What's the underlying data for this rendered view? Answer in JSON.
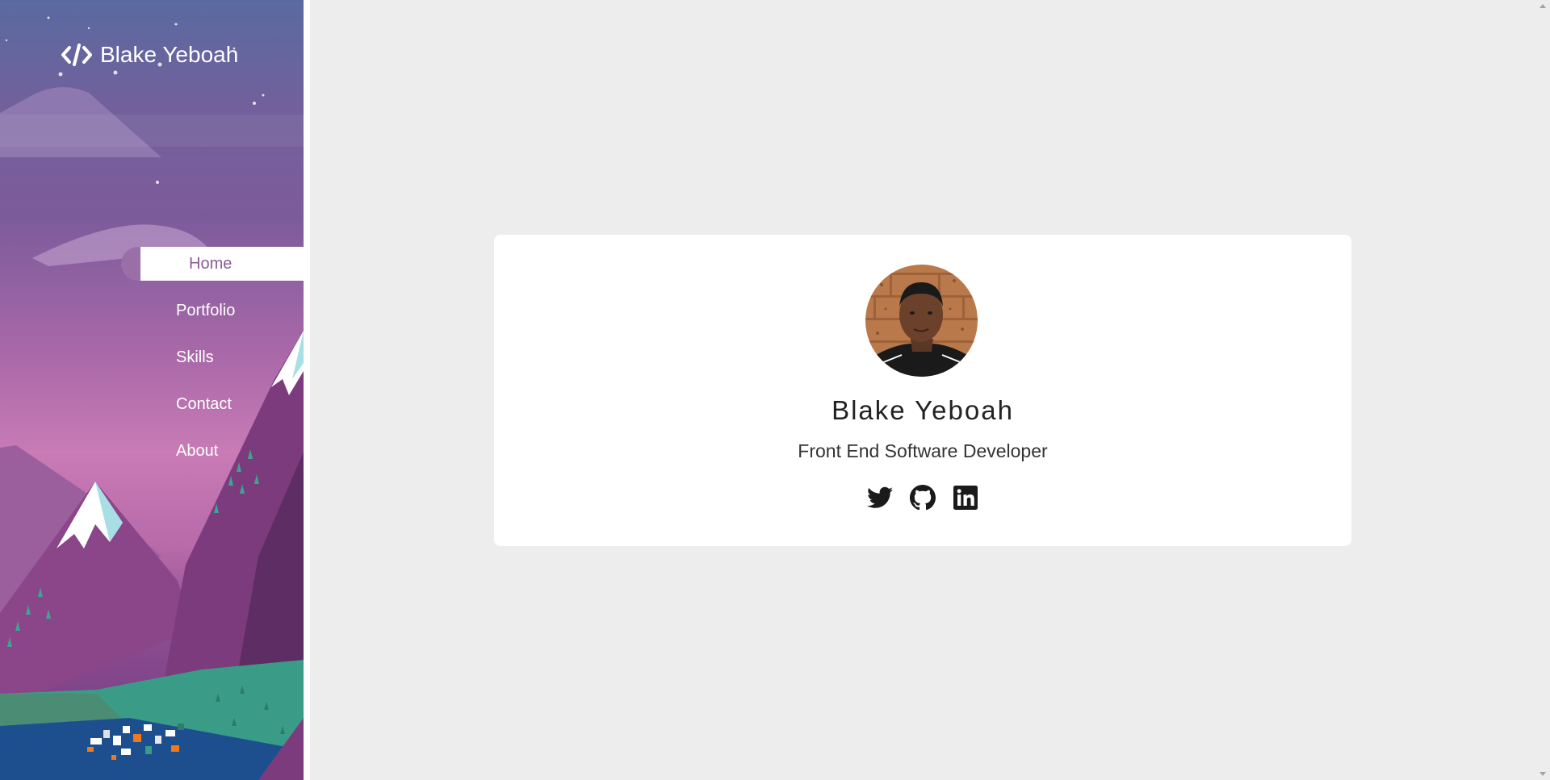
{
  "brand": {
    "name": "Blake Yeboah",
    "icon": "code-icon"
  },
  "nav": {
    "items": [
      {
        "label": "Home",
        "active": true
      },
      {
        "label": "Portfolio",
        "active": false
      },
      {
        "label": "Skills",
        "active": false
      },
      {
        "label": "Contact",
        "active": false
      },
      {
        "label": "About",
        "active": false
      }
    ]
  },
  "profile": {
    "name": "Blake Yeboah",
    "role": "Front End Software Developer",
    "socials": [
      {
        "icon": "twitter-icon"
      },
      {
        "icon": "github-icon"
      },
      {
        "icon": "linkedin-icon"
      }
    ]
  },
  "colors": {
    "accent": "#8b5a96",
    "page_background": "#ededed",
    "card_background": "#ffffff"
  }
}
